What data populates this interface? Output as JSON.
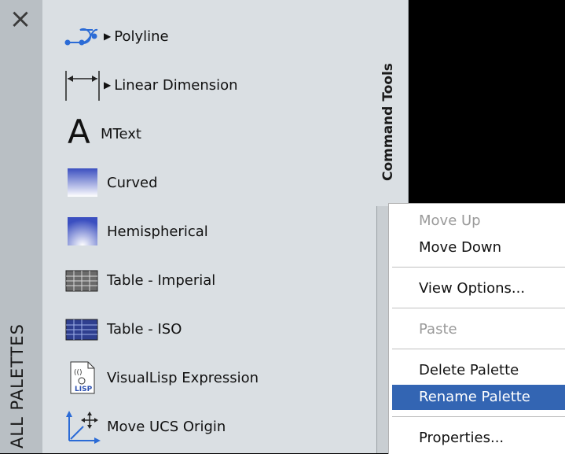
{
  "side": {
    "close_glyph": "×",
    "label": "ALL PALETTES"
  },
  "tab": {
    "label": "Command Tools"
  },
  "tools": [
    {
      "label": "Polyline",
      "icon": "polyline-icon",
      "flyout": true
    },
    {
      "label": "Linear Dimension",
      "icon": "linear-dimension-icon",
      "flyout": true
    },
    {
      "label": "MText",
      "icon": "mtext-icon",
      "flyout": false
    },
    {
      "label": "Curved",
      "icon": "curved-gradient-icon",
      "flyout": false
    },
    {
      "label": "Hemispherical",
      "icon": "hemispherical-gradient-icon",
      "flyout": false
    },
    {
      "label": "Table - Imperial",
      "icon": "table-imperial-icon",
      "flyout": false
    },
    {
      "label": "Table - ISO",
      "icon": "table-iso-icon",
      "flyout": false
    },
    {
      "label": "VisualLisp Expression",
      "icon": "visuallisp-icon",
      "flyout": false,
      "icon_text": "LISP"
    },
    {
      "label": "Move UCS Origin",
      "icon": "move-ucs-origin-icon",
      "flyout": false
    }
  ],
  "mtext_glyph": "A",
  "flyout_glyph": "▶",
  "context_menu": {
    "items": [
      {
        "label": "Move Up",
        "disabled": true
      },
      {
        "label": "Move Down",
        "disabled": false
      },
      {
        "label": "View Options...",
        "disabled": false
      },
      {
        "label": "Paste",
        "disabled": true
      },
      {
        "label": "Delete Palette",
        "disabled": false
      },
      {
        "label": "Rename Palette",
        "disabled": false,
        "highlighted": true
      },
      {
        "label": "Properties...",
        "disabled": false
      }
    ]
  },
  "colors": {
    "highlight": "#3365b3",
    "panel": "#dadfe3",
    "strip": "#b9bfc4",
    "gradient_top": "#3b4fc0",
    "gradient_bottom": "#ffffff"
  }
}
